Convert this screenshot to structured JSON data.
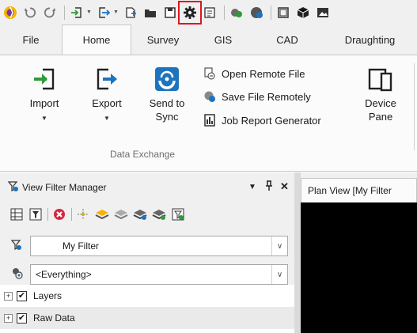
{
  "quick_access": {
    "icons": [
      "logo-icon",
      "undo-icon",
      "redo-icon",
      "import-small-icon",
      "export-small-icon",
      "new-icon",
      "open-icon",
      "save-icon",
      "settings-icon",
      "report-icon",
      "layers-icon",
      "globe-icon",
      "window-icon",
      "cube-icon",
      "image-icon"
    ]
  },
  "tabs": [
    {
      "label": "File"
    },
    {
      "label": "Home",
      "active": true
    },
    {
      "label": "Survey"
    },
    {
      "label": "GIS"
    },
    {
      "label": "CAD"
    },
    {
      "label": "Draughting"
    }
  ],
  "ribbon": {
    "import": {
      "line1": "Import",
      "has_menu": true
    },
    "export": {
      "line1": "Export",
      "has_menu": true
    },
    "send_to_sync": {
      "line1": "Send to",
      "line2": "Sync"
    },
    "open_remote": "Open Remote File",
    "save_remote": "Save File Remotely",
    "job_report": "Job Report Generator",
    "device_pane": {
      "line1": "Device",
      "line2": "Pane"
    },
    "group_label": "Data Exchange"
  },
  "panel": {
    "title": "View Filter Manager",
    "pin": "F",
    "close": "✕",
    "filter_value": "My Filter",
    "scope_value": "<Everything>",
    "tree": [
      {
        "label": "Layers",
        "checked": true
      },
      {
        "label": "Raw Data",
        "checked": true
      }
    ]
  },
  "view": {
    "tab_label": "Plan View [My Filter"
  },
  "colors": {
    "accent_blue": "#1e73be",
    "accent_green": "#2e9b3a",
    "highlight_red": "#e0161c",
    "view_background": "#000000"
  }
}
